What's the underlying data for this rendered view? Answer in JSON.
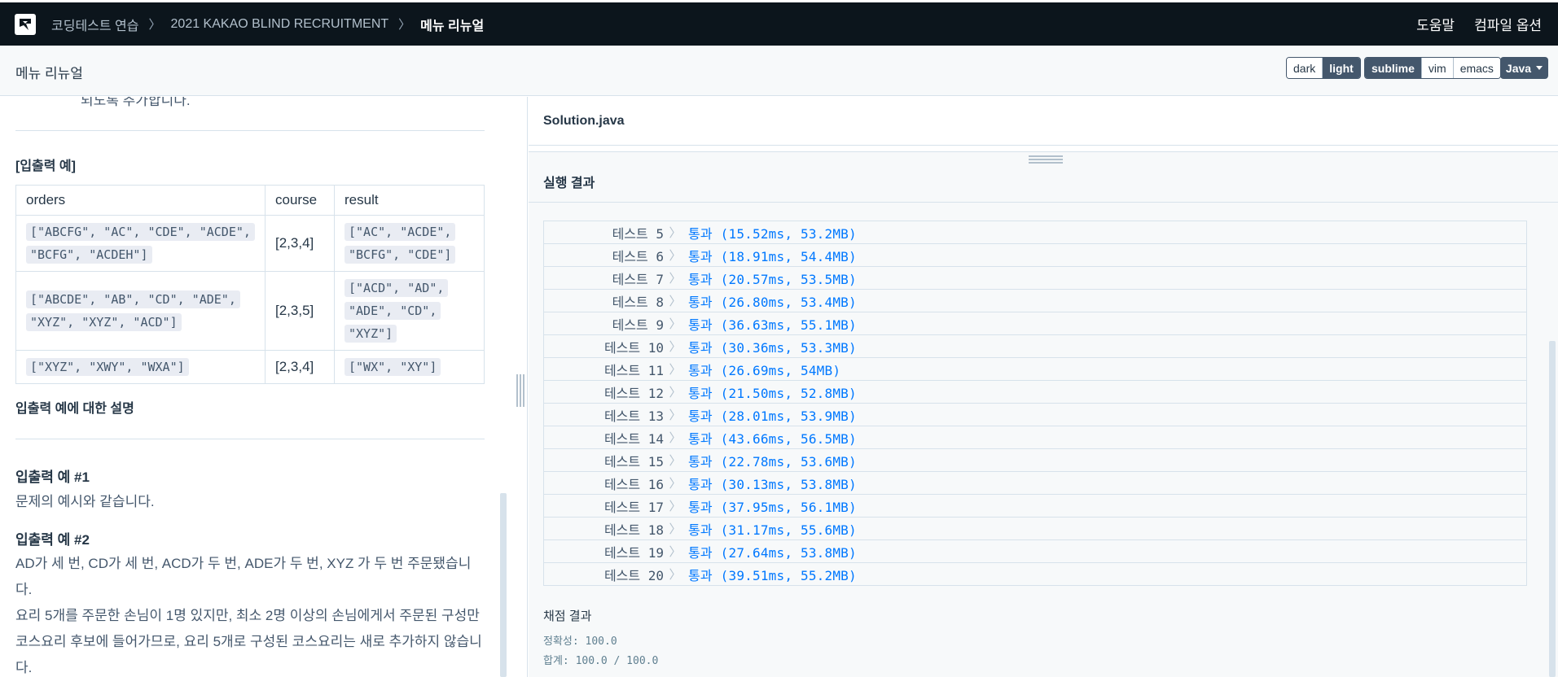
{
  "nav": {
    "breadcrumbs": [
      "코딩테스트 연습",
      "2021 KAKAO BLIND RECRUITMENT",
      "메뉴 리뉴얼"
    ],
    "help": "도움말",
    "compile_options": "컴파일 옵션"
  },
  "subheader": {
    "title": "메뉴 리뉴얼",
    "theme_options": [
      "dark",
      "light"
    ],
    "theme_selected": "light",
    "keymap_options": [
      "sublime",
      "vim",
      "emacs"
    ],
    "keymap_selected": "sublime",
    "language": "Java"
  },
  "description": {
    "cut_text": "되도록 추가합니다.",
    "io_heading": "[입출력 예]",
    "table": {
      "headers": [
        "orders",
        "course",
        "result"
      ],
      "rows": [
        {
          "orders": "[\"ABCFG\", \"AC\", \"CDE\", \"ACDE\", \"BCFG\", \"ACDEH\"]",
          "course": "[2,3,4]",
          "result": "[\"AC\", \"ACDE\", \"BCFG\", \"CDE\"]"
        },
        {
          "orders": "[\"ABCDE\", \"AB\", \"CD\", \"ADE\", \"XYZ\", \"XYZ\", \"ACD\"]",
          "course": "[2,3,5]",
          "result": "[\"ACD\", \"AD\", \"ADE\", \"CD\", \"XYZ\"]"
        },
        {
          "orders": "[\"XYZ\", \"XWY\", \"WXA\"]",
          "course": "[2,3,4]",
          "result": "[\"WX\", \"XY\"]"
        }
      ]
    },
    "explain_heading": "입출력 예에 대한 설명",
    "example1_heading": "입출력 예 #1",
    "example1_text": "문제의 예시와 같습니다.",
    "example2_heading": "입출력 예 #2",
    "example2_text": "AD가 세 번, CD가 세 번, ACD가 두 번, ADE가 두 번, XYZ 가 두 번 주문됐습니다.",
    "example2_text2": "요리 5개를 주문한 손님이 1명 있지만, 최소 2명 이상의 손님에게서 주문된 구성만 코스요리 후보에 들어가므로, 요리 5개로 구성된 코스요리는 새로 추가하지 않습니다."
  },
  "editor": {
    "filename": "Solution.java"
  },
  "results": {
    "heading": "실행 결과",
    "tests": [
      {
        "name": "테스트 5",
        "result": "통과 (15.52ms, 53.2MB)"
      },
      {
        "name": "테스트 6",
        "result": "통과 (18.91ms, 54.4MB)"
      },
      {
        "name": "테스트 7",
        "result": "통과 (20.57ms, 53.5MB)"
      },
      {
        "name": "테스트 8",
        "result": "통과 (26.80ms, 53.4MB)"
      },
      {
        "name": "테스트 9",
        "result": "통과 (36.63ms, 55.1MB)"
      },
      {
        "name": "테스트 10",
        "result": "통과 (30.36ms, 53.3MB)"
      },
      {
        "name": "테스트 11",
        "result": "통과 (26.69ms, 54MB)"
      },
      {
        "name": "테스트 12",
        "result": "통과 (21.50ms, 52.8MB)"
      },
      {
        "name": "테스트 13",
        "result": "통과 (28.01ms, 53.9MB)"
      },
      {
        "name": "테스트 14",
        "result": "통과 (43.66ms, 56.5MB)"
      },
      {
        "name": "테스트 15",
        "result": "통과 (22.78ms, 53.6MB)"
      },
      {
        "name": "테스트 16",
        "result": "통과 (30.13ms, 53.8MB)"
      },
      {
        "name": "테스트 17",
        "result": "통과 (37.95ms, 56.1MB)"
      },
      {
        "name": "테스트 18",
        "result": "통과 (31.17ms, 55.6MB)"
      },
      {
        "name": "테스트 19",
        "result": "통과 (27.64ms, 53.8MB)"
      },
      {
        "name": "테스트 20",
        "result": "통과 (39.51ms, 55.2MB)"
      }
    ],
    "grading_heading": "채점 결과",
    "accuracy": "정확성: 100.0",
    "total": "합계: 100.0 / 100.0"
  },
  "colors": {
    "nav_bg": "#0c151c",
    "pass": "#0078ff",
    "button_dark": "#44576c"
  }
}
